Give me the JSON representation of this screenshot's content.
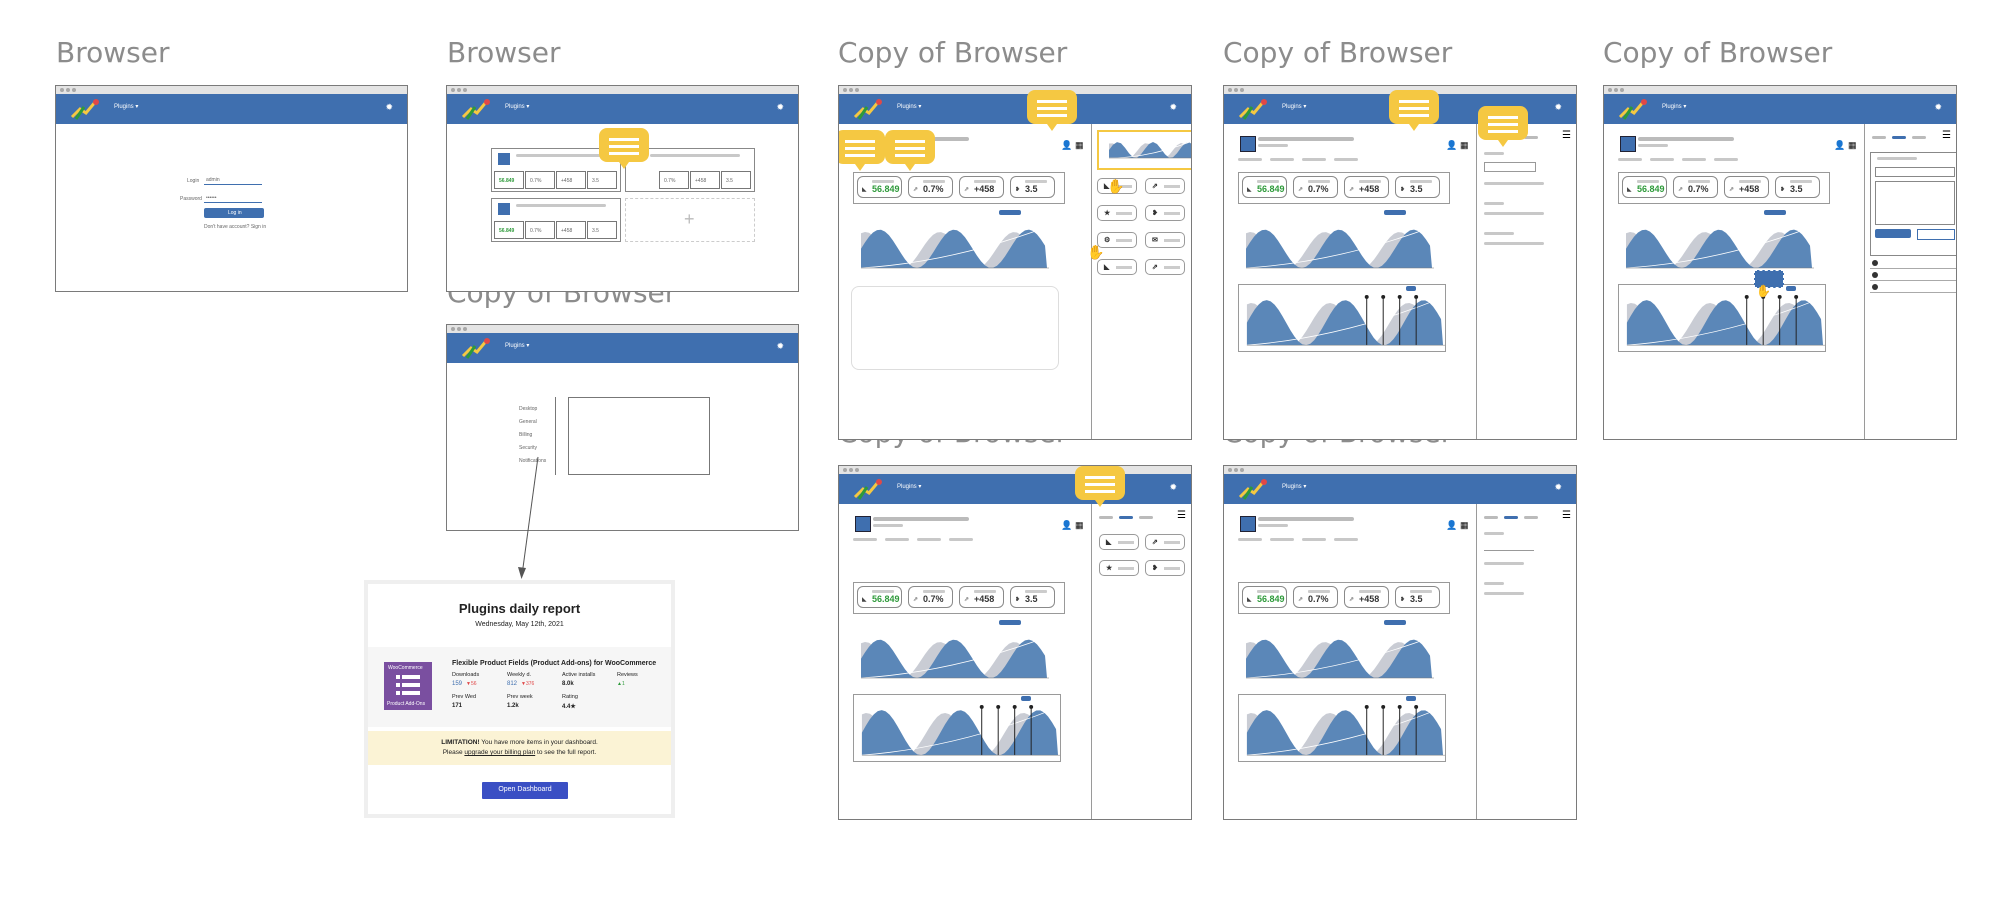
{
  "frames": [
    {
      "id": "f1",
      "title": "Browser"
    },
    {
      "id": "f2",
      "title": "Browser"
    },
    {
      "id": "f3",
      "title": "Copy of Browser"
    },
    {
      "id": "f4",
      "title": "Copy of Browser"
    },
    {
      "id": "f5",
      "title": "Copy of Browser"
    },
    {
      "id": "f6",
      "title": "Copy of Browser"
    },
    {
      "id": "f7",
      "title": "Copy of Browser"
    },
    {
      "id": "f8",
      "title": "Copy of Browser"
    }
  ],
  "nav": {
    "menu_label": "Plugins ▾"
  },
  "login": {
    "login_label": "Login",
    "password_label": "Password",
    "login_value": "admin",
    "password_value": "••••••",
    "button_label": "Log in",
    "footer": "Don't have account? Sign in"
  },
  "kpis": [
    {
      "value": "56.849",
      "icon": "◣"
    },
    {
      "value": "0.7%",
      "icon": "⇗"
    },
    {
      "value": "+458",
      "icon": "⇗"
    },
    {
      "value": "3.5",
      "icon": "❥"
    }
  ],
  "menu_items": [
    "Desktop",
    "General",
    "Billing",
    "Security",
    "Notifications"
  ],
  "report": {
    "title": "Plugins daily report",
    "date": "Wednesday, May 12th, 2021",
    "product": "Flexible Product Fields (Product Add-ons) for WooCommerce",
    "thumb_top": "WooCommerce",
    "thumb_bottom": "Product Add-Ons",
    "stats": [
      {
        "label": "Downloads",
        "value": "159",
        "delta": "▼56"
      },
      {
        "label": "Weekly d.",
        "value": "812",
        "delta": "▼376"
      },
      {
        "label": "Active installs",
        "value": "8.0k",
        "delta": ""
      },
      {
        "label": "Reviews",
        "value": "",
        "delta": "▲1"
      },
      {
        "label": "Prev Wed",
        "value": "171",
        "delta": ""
      },
      {
        "label": "Prev week",
        "value": "1.2k",
        "delta": ""
      },
      {
        "label": "Rating",
        "value": "4.4★",
        "delta": ""
      }
    ],
    "limitation_strong": "LIMITATION!",
    "limitation_text": " You have more items in your dashboard.",
    "limitation_line2a": "Please ",
    "limitation_link": "upgrade your billing plan",
    "limitation_line2b": " to see the full report.",
    "button": "Open Dashboard"
  },
  "colors": {
    "nav": "#3f6faf",
    "bubble": "#f5c842",
    "area_blue": "#5b87b8",
    "area_gray": "#c9ccd4",
    "positive": "#2e9a3a"
  }
}
